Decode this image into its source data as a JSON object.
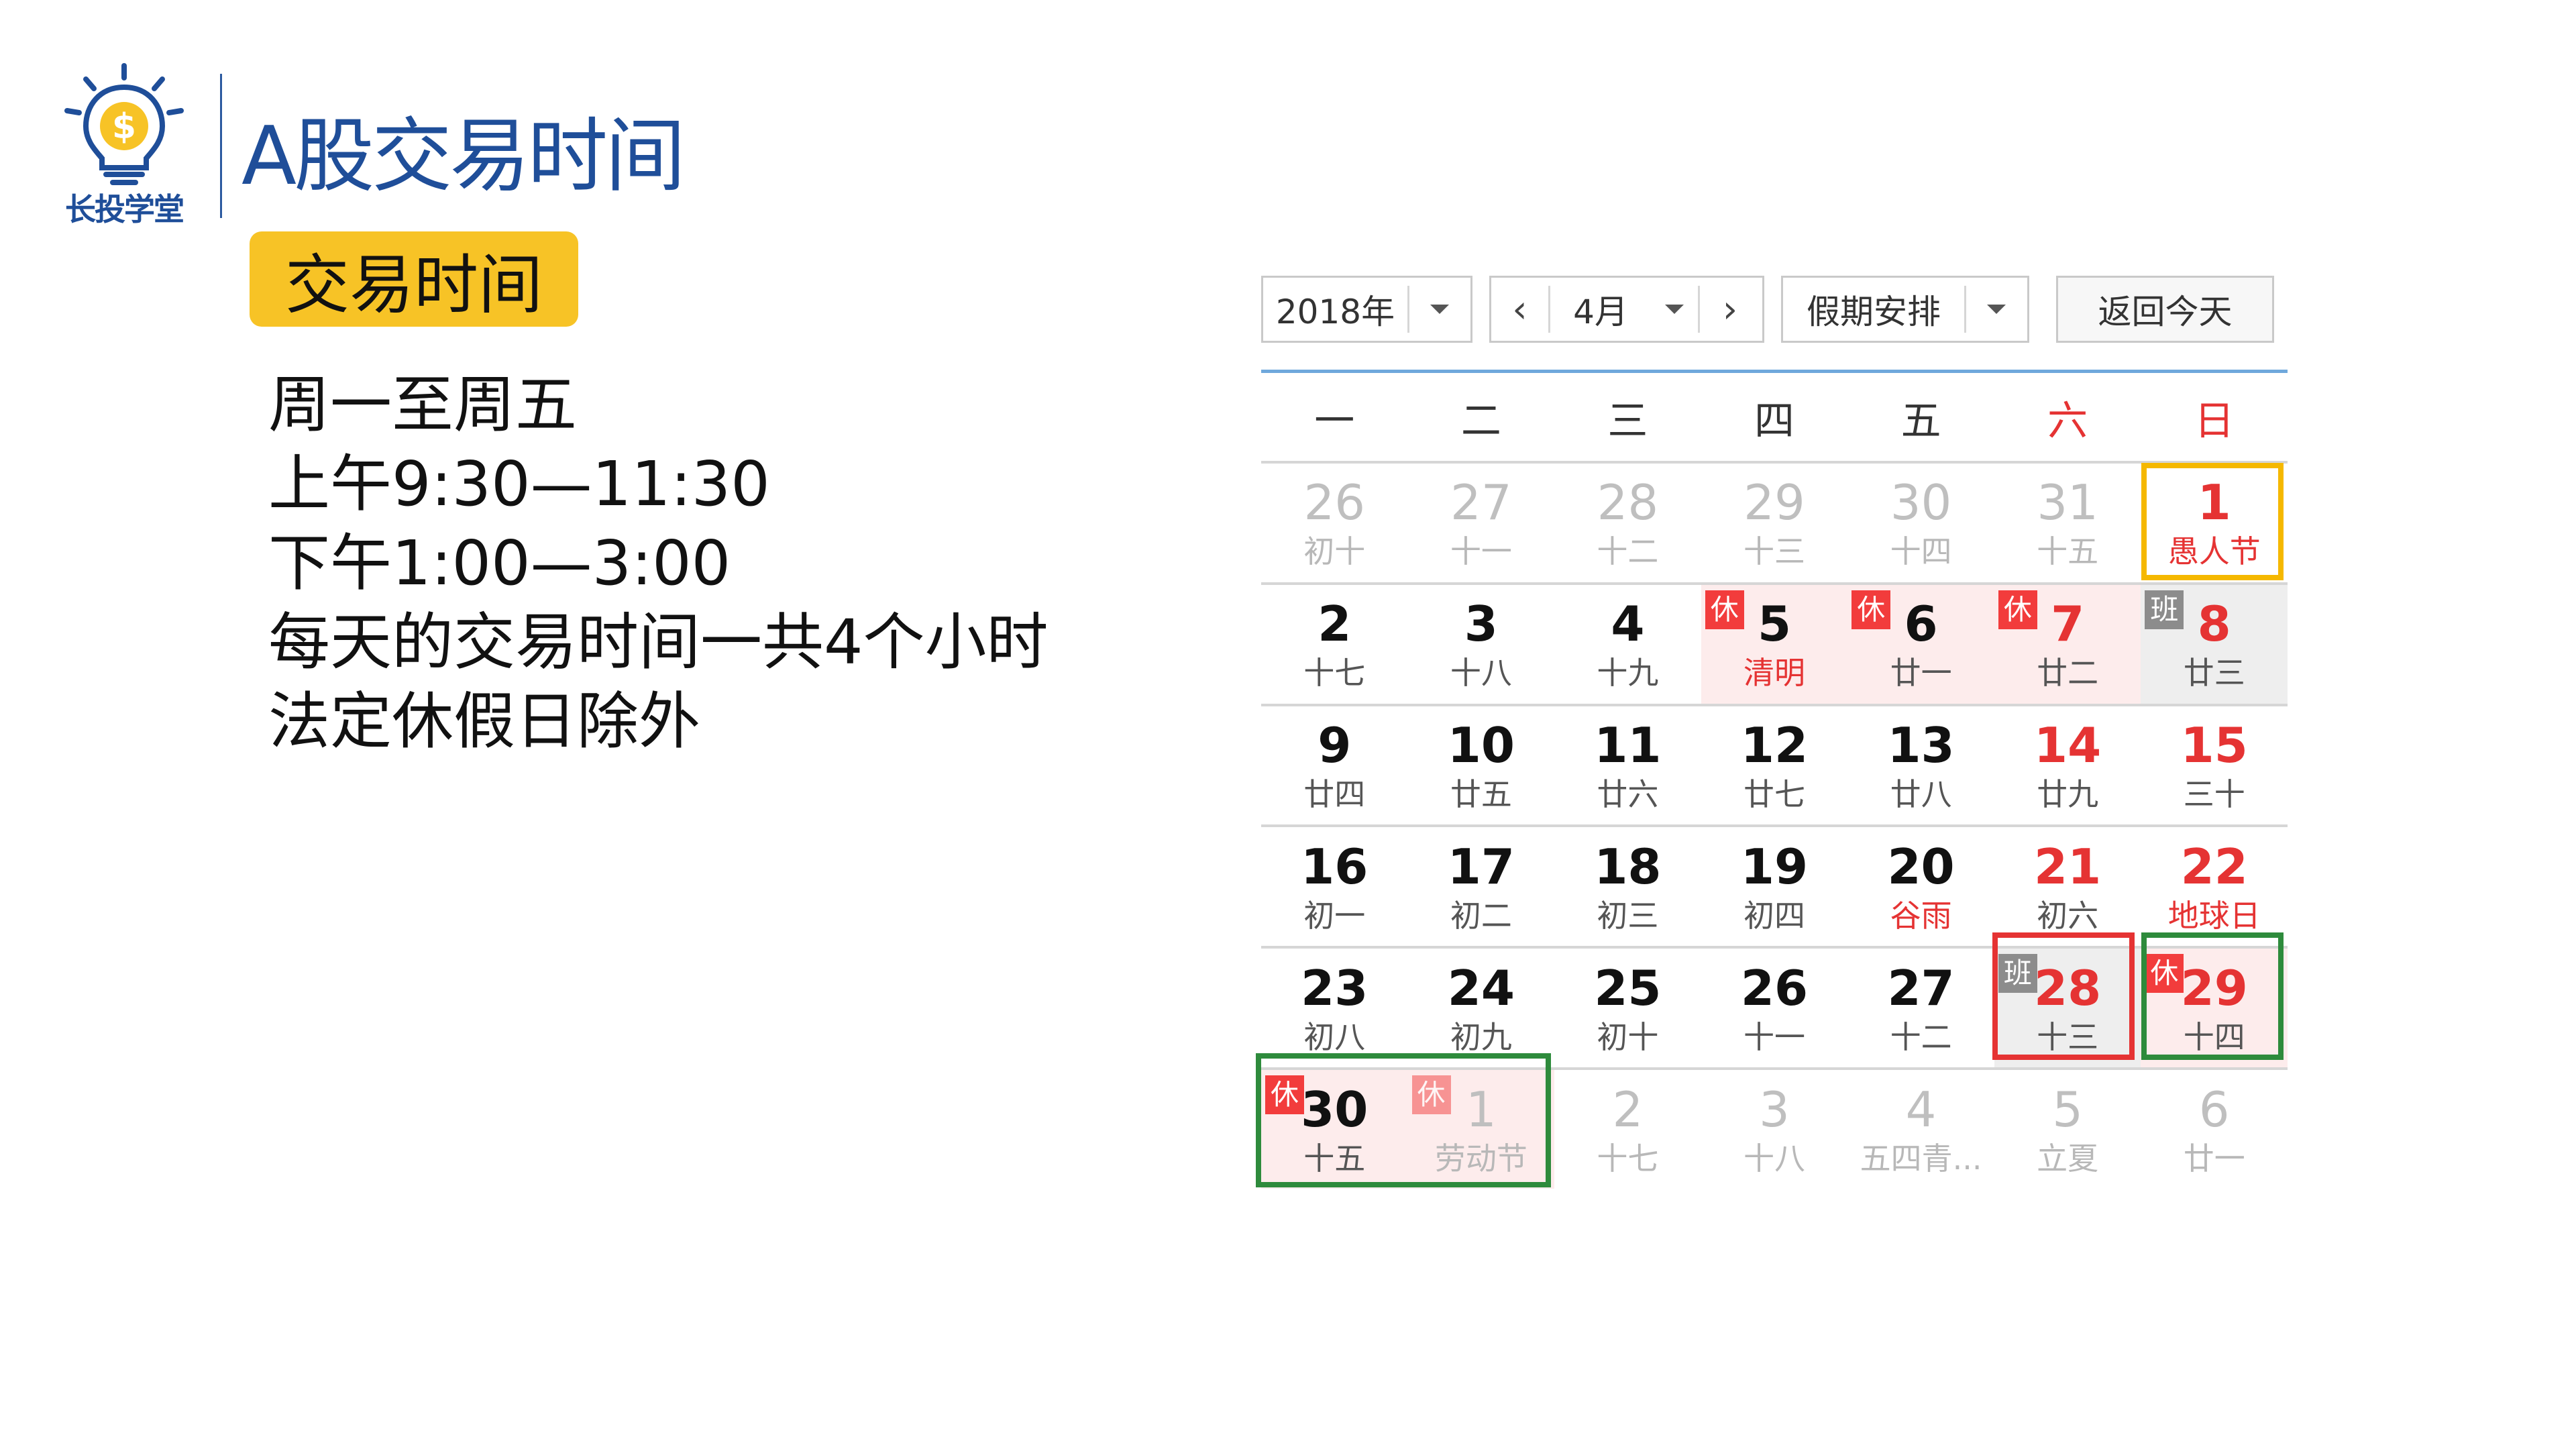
{
  "header": {
    "logo_text": "长投学堂",
    "title": "A股交易时间"
  },
  "section": {
    "badge": "交易时间",
    "lines": [
      "周一至周五",
      "上午9:30—11:30",
      "下午1:00—3:00",
      "每天的交易时间一共4个小时",
      "法定休假日除外"
    ]
  },
  "calendar": {
    "year": "2018年",
    "month": "4月",
    "holiday_dropdown": "假期安排",
    "today_button": "返回今天",
    "weekdays": [
      "一",
      "二",
      "三",
      "四",
      "五",
      "六",
      "日"
    ],
    "days": [
      {
        "d": "26",
        "l": "初十",
        "state": "other"
      },
      {
        "d": "27",
        "l": "十一",
        "state": "other"
      },
      {
        "d": "28",
        "l": "十二",
        "state": "other"
      },
      {
        "d": "29",
        "l": "十三",
        "state": "other"
      },
      {
        "d": "30",
        "l": "十四",
        "state": "other"
      },
      {
        "d": "31",
        "l": "十五",
        "state": "other"
      },
      {
        "d": "1",
        "l": "愚人节",
        "state": "weekend",
        "festival": true
      },
      {
        "d": "2",
        "l": "十七"
      },
      {
        "d": "3",
        "l": "十八"
      },
      {
        "d": "4",
        "l": "十九"
      },
      {
        "d": "5",
        "l": "清明",
        "festival": true,
        "bg": "holiday",
        "tag": "休"
      },
      {
        "d": "6",
        "l": "廿一",
        "bg": "holiday",
        "tag": "休"
      },
      {
        "d": "7",
        "l": "廿二",
        "state": "weekend",
        "bg": "holiday",
        "tag": "休"
      },
      {
        "d": "8",
        "l": "廿三",
        "state": "weekend",
        "bg": "workday",
        "tag": "班"
      },
      {
        "d": "9",
        "l": "廿四"
      },
      {
        "d": "10",
        "l": "廿五"
      },
      {
        "d": "11",
        "l": "廿六"
      },
      {
        "d": "12",
        "l": "廿七"
      },
      {
        "d": "13",
        "l": "廿八"
      },
      {
        "d": "14",
        "l": "廿九",
        "state": "weekend"
      },
      {
        "d": "15",
        "l": "三十",
        "state": "weekend"
      },
      {
        "d": "16",
        "l": "初一"
      },
      {
        "d": "17",
        "l": "初二"
      },
      {
        "d": "18",
        "l": "初三"
      },
      {
        "d": "19",
        "l": "初四"
      },
      {
        "d": "20",
        "l": "谷雨",
        "festival": true
      },
      {
        "d": "21",
        "l": "初六",
        "state": "weekend"
      },
      {
        "d": "22",
        "l": "地球日",
        "state": "weekend",
        "festival": true
      },
      {
        "d": "23",
        "l": "初八"
      },
      {
        "d": "24",
        "l": "初九"
      },
      {
        "d": "25",
        "l": "初十"
      },
      {
        "d": "26",
        "l": "十一"
      },
      {
        "d": "27",
        "l": "十二"
      },
      {
        "d": "28",
        "l": "十三",
        "state": "weekend",
        "bg": "workday",
        "tag": "班"
      },
      {
        "d": "29",
        "l": "十四",
        "state": "weekend",
        "bg": "holiday",
        "tag": "休"
      },
      {
        "d": "30",
        "l": "十五",
        "bg": "holiday",
        "tag": "休"
      },
      {
        "d": "1",
        "l": "劳动节",
        "state": "other",
        "bg": "holiday",
        "tag": "休",
        "faded_tag": true
      },
      {
        "d": "2",
        "l": "十七",
        "state": "other"
      },
      {
        "d": "3",
        "l": "十八",
        "state": "other"
      },
      {
        "d": "4",
        "l": "五四青...",
        "state": "other"
      },
      {
        "d": "5",
        "l": "立夏",
        "state": "other"
      },
      {
        "d": "6",
        "l": "廿一",
        "state": "other"
      }
    ]
  },
  "colors": {
    "accent_blue": "#1f4e99",
    "badge_yellow": "#f7c326",
    "highlight_orange": "#f5b800",
    "highlight_red": "#e53333",
    "highlight_green": "#2e8b3c"
  }
}
